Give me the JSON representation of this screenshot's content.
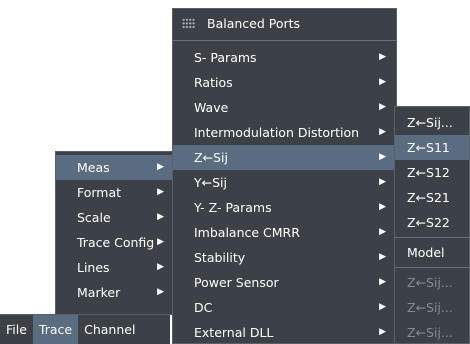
{
  "menubar": {
    "items": [
      {
        "label": "File",
        "active": false
      },
      {
        "label": "Trace",
        "active": true
      },
      {
        "label": "Channel",
        "active": false
      }
    ]
  },
  "trace_menu": {
    "items": [
      {
        "label": "Meas",
        "submenu": true,
        "highlighted": true
      },
      {
        "label": "Format",
        "submenu": true
      },
      {
        "label": "Scale",
        "submenu": true
      },
      {
        "label": "Trace Config",
        "submenu": true
      },
      {
        "label": "Lines",
        "submenu": true
      },
      {
        "label": "Marker",
        "submenu": true
      }
    ]
  },
  "meas_menu": {
    "title": "Balanced Ports",
    "title_icon": "grid-icon",
    "items": [
      {
        "label": "S- Params",
        "submenu": true
      },
      {
        "label": "Ratios",
        "submenu": true
      },
      {
        "label": "Wave",
        "submenu": true
      },
      {
        "label": "Intermodulation Distortion",
        "submenu": true
      },
      {
        "label": "Z←Sij",
        "submenu": true,
        "highlighted": true
      },
      {
        "label": "Y←Sij",
        "submenu": true
      },
      {
        "label": "Y- Z-  Params",
        "submenu": true
      },
      {
        "label": "Imbalance CMRR",
        "submenu": true
      },
      {
        "label": "Stability",
        "submenu": true
      },
      {
        "label": "Power Sensor",
        "submenu": true
      },
      {
        "label": "DC",
        "submenu": true
      },
      {
        "label": "External DLL",
        "submenu": true
      }
    ]
  },
  "zsij_menu": {
    "items": [
      {
        "label": "Z←Sij...",
        "enabled": true
      },
      {
        "label": "Z←S11",
        "enabled": true,
        "highlighted": true
      },
      {
        "label": "Z←S12",
        "enabled": true
      },
      {
        "label": "Z←S21",
        "enabled": true
      },
      {
        "label": "Z←S22",
        "enabled": true
      }
    ],
    "model_label": "Model",
    "disabled_items": [
      {
        "label": "Z←Sij...",
        "enabled": false
      },
      {
        "label": "Z←Sij...",
        "enabled": false
      },
      {
        "label": "Z←Sij...",
        "enabled": false
      }
    ]
  },
  "colors": {
    "menu_bg": "#3c4148",
    "highlight": "#596c80",
    "disabled_text": "#848a92"
  },
  "arrow_glyph": "▶"
}
